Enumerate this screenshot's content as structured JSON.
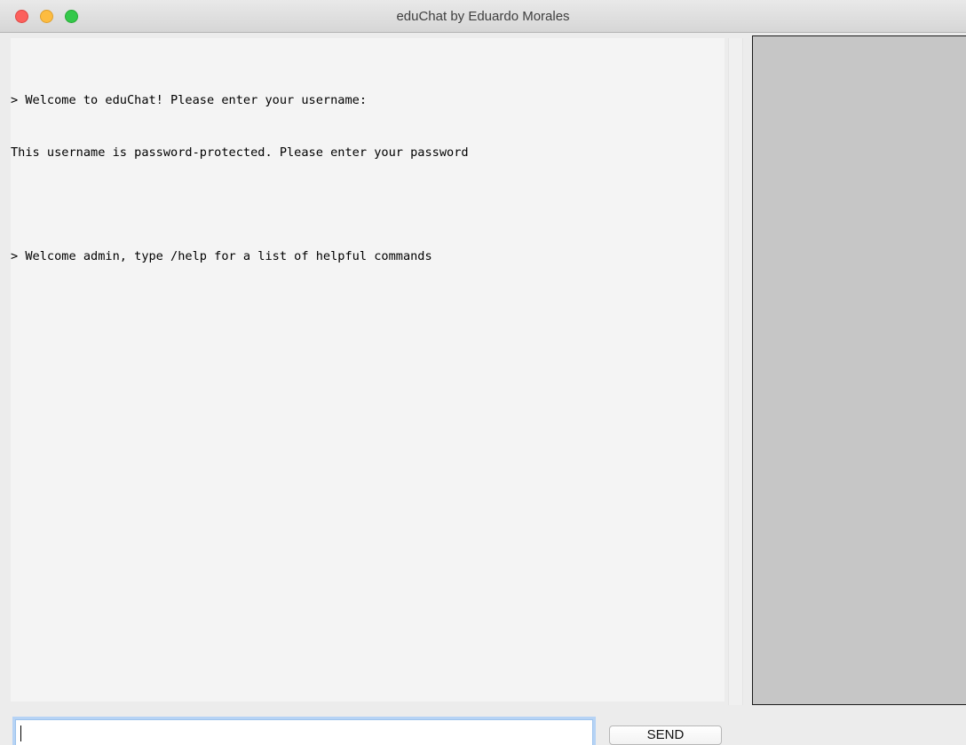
{
  "window": {
    "title": "eduChat by Eduardo Morales"
  },
  "chat_log": {
    "lines": [
      "> Welcome to eduChat! Please enter your username:",
      "This username is password-protected. Please enter your password",
      "",
      "> Welcome admin, type /help for a list of helpful commands"
    ]
  },
  "message_input": {
    "value": "",
    "placeholder": ""
  },
  "send_button": {
    "label": "SEND"
  },
  "colors": {
    "chat_background": "#f4f4f4",
    "users_panel_background": "#c6c6c6",
    "close": "#fc605c",
    "minimize": "#fdbc40",
    "maximize": "#34c84a",
    "input_focus_ring": "#b6d3f5"
  }
}
